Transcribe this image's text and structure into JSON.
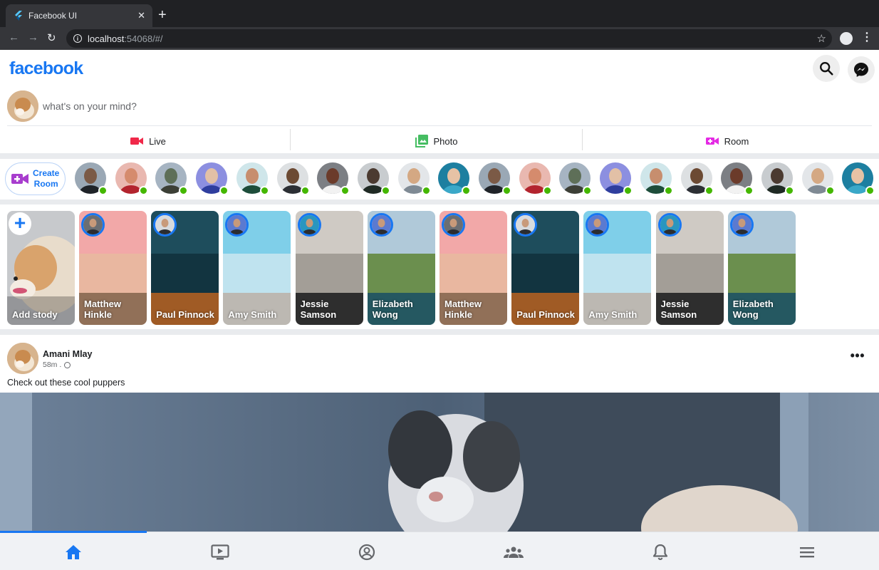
{
  "browser": {
    "tab_title": "Facebook UI",
    "tab_close": "✕",
    "new_tab": "+",
    "url_host": "localhost",
    "url_rest": ":54068/#/"
  },
  "header": {
    "logo": "facebook",
    "search_icon": "search-icon",
    "messenger_icon": "messenger-icon"
  },
  "composer": {
    "placeholder": "what's on your mind?",
    "actions": [
      {
        "label": "Live",
        "icon": "video-camera-icon",
        "color": "#f02849"
      },
      {
        "label": "Photo",
        "icon": "photo-library-icon",
        "color": "#45bd62"
      },
      {
        "label": "Room",
        "icon": "video-call-icon",
        "color": "#e42ae4"
      }
    ]
  },
  "rooms": {
    "create_label_line1": "Create",
    "create_label_line2": "Room",
    "online_count": 20
  },
  "stories": {
    "add_label": "Add stody",
    "items": [
      {
        "name_line1": "Matthew",
        "name_line2": "Hinkle"
      },
      {
        "name_line1": "Paul Pinnock",
        "name_line2": ""
      },
      {
        "name_line1": "Amy Smith",
        "name_line2": ""
      },
      {
        "name_line1": "Jessie",
        "name_line2": "Samson"
      },
      {
        "name_line1": "Elizabeth",
        "name_line2": "Wong"
      },
      {
        "name_line1": "Matthew",
        "name_line2": "Hinkle"
      },
      {
        "name_line1": "Paul Pinnock",
        "name_line2": ""
      },
      {
        "name_line1": "Amy Smith",
        "name_line2": ""
      },
      {
        "name_line1": "Jessie",
        "name_line2": "Samson"
      },
      {
        "name_line1": "Elizabeth",
        "name_line2": "Wong"
      }
    ]
  },
  "post": {
    "author": "Amani Mlay",
    "time": "58m .",
    "caption": "Check out these cool puppers",
    "more": "•••"
  },
  "bottom_nav": {
    "items": [
      "home-icon",
      "ondemand-video-icon",
      "account-circle-icon",
      "groups-icon",
      "notifications-icon",
      "menu-icon"
    ],
    "active_index": 0
  },
  "colors": {
    "brand": "#1877f2",
    "online": "#44b700",
    "divider": "#e9ebee"
  }
}
